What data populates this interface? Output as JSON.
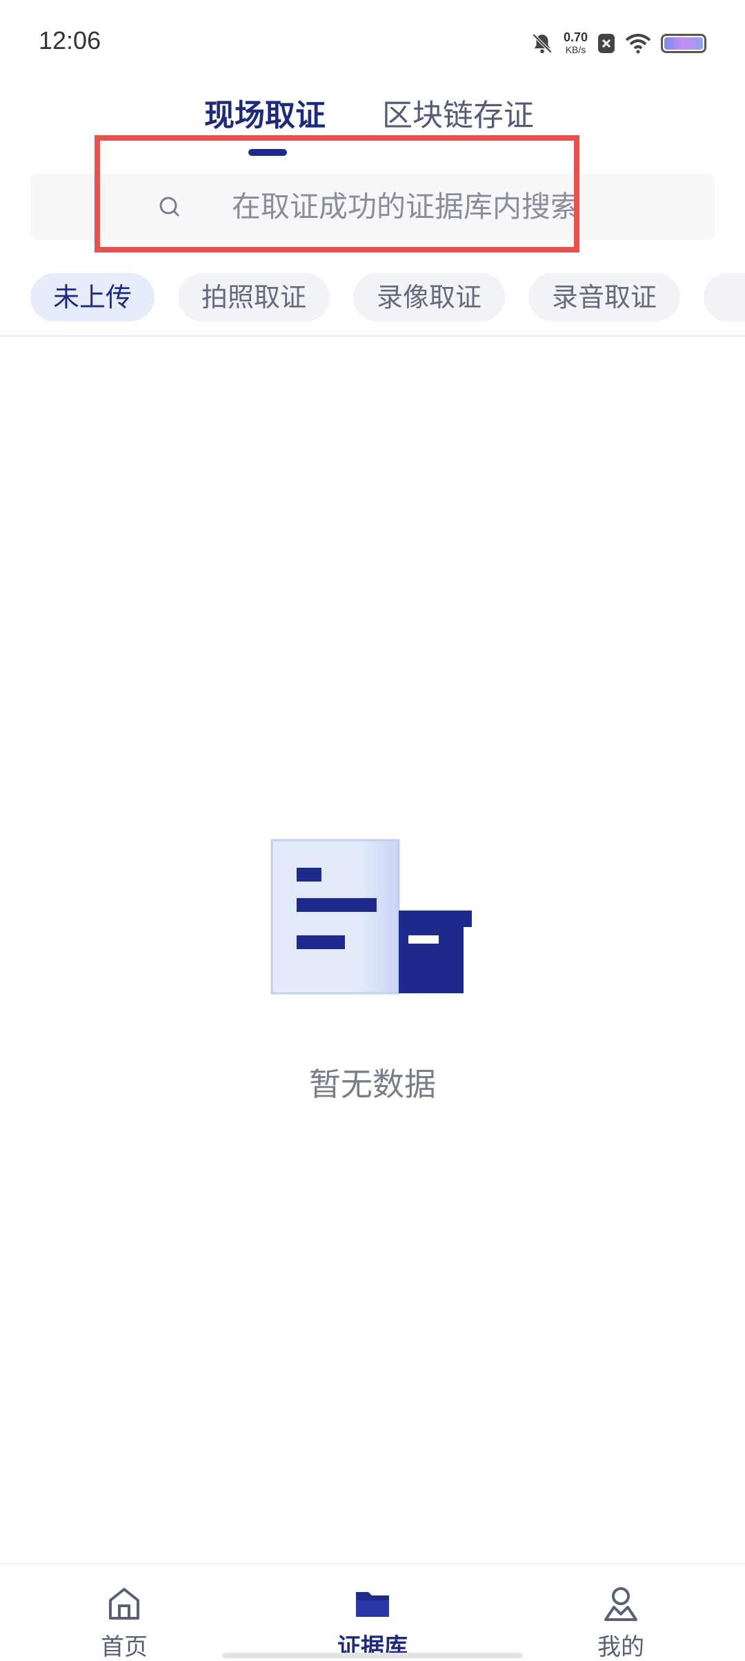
{
  "status_bar": {
    "time": "12:06",
    "net_speed_value": "0.70",
    "net_speed_unit": "KB/s",
    "icons": [
      "mute-bell-icon",
      "close-box-icon",
      "wifi-icon",
      "battery-icon"
    ]
  },
  "tabs": [
    {
      "label": "现场取证",
      "active": true
    },
    {
      "label": "区块链存证",
      "active": false
    }
  ],
  "search": {
    "placeholder": "在取证成功的证据库内搜索"
  },
  "chips": [
    {
      "label": "未上传",
      "active": true
    },
    {
      "label": "拍照取证",
      "active": false
    },
    {
      "label": "录像取证",
      "active": false
    },
    {
      "label": "录音取证",
      "active": false
    }
  ],
  "empty_state": {
    "message": "暂无数据"
  },
  "bottom_nav": [
    {
      "label": "首页",
      "icon": "home-icon",
      "active": false
    },
    {
      "label": "证据库",
      "icon": "folder-icon",
      "active": true
    },
    {
      "label": "我的",
      "icon": "user-icon",
      "active": false
    }
  ],
  "colors": {
    "accent": "#1e2a7c",
    "highlight": "#e8524c",
    "chip_bg": "#f2f3f6",
    "chip_active_bg": "#e7ecfb"
  }
}
